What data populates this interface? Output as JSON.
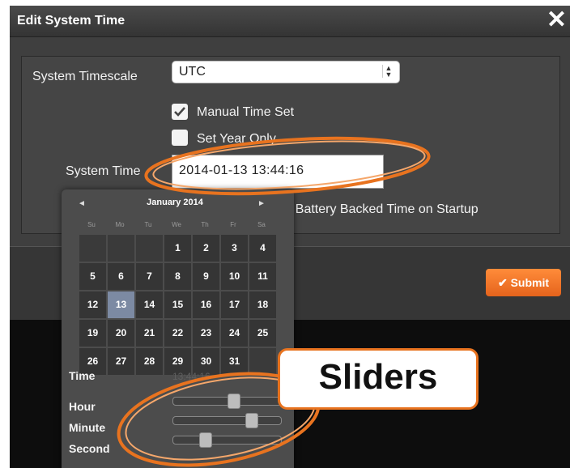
{
  "dialog": {
    "title": "Edit System Time",
    "close_glyph": "✕",
    "timescale_label": "System Timescale",
    "timescale_value": "UTC",
    "manual_time_set_label": "Manual Time Set",
    "set_year_only_label": "Set Year Only",
    "system_time_label": "System Time",
    "system_time_value": "2014-01-13 13:44:16",
    "battery_backed_label": "to Battery Backed Time on Startup",
    "submit_label": "Submit",
    "manual_time_set_checked": true,
    "set_year_only_checked": false
  },
  "calendar": {
    "prev_glyph": "◄",
    "next_glyph": "►",
    "month_label": "January 2014",
    "weekdays": [
      "Su",
      "Mo",
      "Tu",
      "We",
      "Th",
      "Fr",
      "Sa"
    ],
    "days": [
      "",
      "",
      "",
      "1",
      "2",
      "3",
      "4",
      "5",
      "6",
      "7",
      "8",
      "9",
      "10",
      "11",
      "12",
      "13",
      "14",
      "15",
      "16",
      "17",
      "18",
      "19",
      "20",
      "21",
      "22",
      "23",
      "24",
      "25",
      "26",
      "27",
      "28",
      "29",
      "30",
      "31",
      ""
    ],
    "selected_day": "13",
    "time_label": "Time",
    "time_value": "13:44:16",
    "hour_label": "Hour",
    "minute_label": "Minute",
    "second_label": "Second",
    "hour": 13,
    "minute": 44,
    "second": 16
  },
  "annotation": {
    "callout_text": "Sliders"
  },
  "colors": {
    "accent": "#e8731f",
    "selected_day": "#7c8aa3",
    "submit": "#f07a2a"
  },
  "icons": {
    "close": "close-icon",
    "checkmark": "checkmark-icon",
    "select_arrows": "updown-arrows-icon",
    "prev": "chevron-left-icon",
    "next": "chevron-right-icon"
  }
}
